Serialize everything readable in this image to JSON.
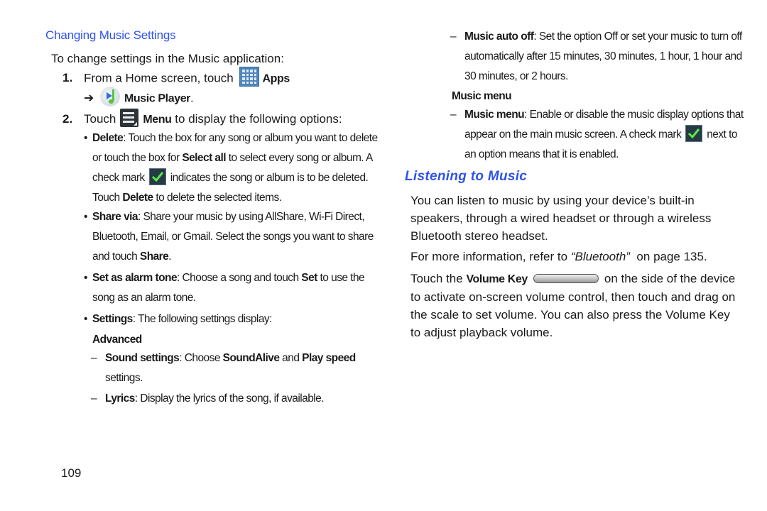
{
  "page_number": "109",
  "left_column": {
    "section_title": "Changing Music Settings",
    "intro": "To change settings in the Music application:",
    "step1": {
      "number": "1.",
      "text_before": "From a Home screen, touch",
      "apps_icon": "apps-grid-icon",
      "apps_label": "Apps",
      "arrow": "➔",
      "music_icon": "music-player-icon",
      "music_label": "Music Player",
      "end": "."
    },
    "step2": {
      "number": "2.",
      "text_before": "Touch",
      "menu_icon": "menu-icon",
      "menu_label": "Menu",
      "text_after": "to display the following options:"
    },
    "bullets": {
      "delete": {
        "label": "Delete",
        "line1": ": Touch the box for any song or album you want to delete",
        "line2_a": "or touch the box for ",
        "line2_b": "Select all",
        "line2_c": " to select every song or album. A",
        "line3_a": "check mark",
        "check_icon": "checkmark-icon",
        "line3_b": "indicates the song or album is to be deleted.",
        "line4_a": "Touch ",
        "line4_b": "Delete",
        "line4_c": " to delete the selected items."
      },
      "share": {
        "label": "Share via",
        "line1": ": Share your music by using AllShare, Wi-Fi Direct,",
        "line2": "Bluetooth, Email, or Gmail. Select the songs you want to share",
        "line3_a": "and touch ",
        "line3_b": "Share",
        "line3_c": "."
      },
      "alarm": {
        "label": "Set as alarm tone",
        "line1_a": ": Choose a song and touch ",
        "line1_b": "Set",
        "line1_c": " to use the",
        "line2": "song as an alarm tone."
      },
      "settings": {
        "label": "Settings",
        "line1": ": The following settings display:"
      }
    },
    "advanced": {
      "heading": "Advanced",
      "sound": {
        "label": "Sound settings",
        "a": ": Choose ",
        "b": "SoundAlive",
        "c": " and ",
        "d": "Play speed",
        "line2": "settings."
      },
      "lyrics": {
        "label": "Lyrics",
        "text": ": Display the lyrics of the song, if available."
      }
    },
    "bullet_char": "•",
    "dash_char": "–"
  },
  "right_column": {
    "auto_off": {
      "label": "Music auto off",
      "line1": ": Set the option Off or set your music to turn off",
      "line2": "automatically after 15 minutes, 30 minutes, 1 hour, 1 hour and",
      "line3": "30 minutes, or 2 hours."
    },
    "music_menu_heading": "Music menu",
    "music_menu": {
      "label": "Music menu",
      "line1": ": Enable or disable the music display options that",
      "line2_a": "appear on the main music screen. A check mark",
      "line2_b": "next to",
      "line3": "an option means that it is enabled."
    },
    "listening_title": "Listening to Music",
    "para1": [
      "You can listen to music by using your device’s built-in",
      "speakers, through a wired headset or through a wireless",
      "Bluetooth stereo headset."
    ],
    "ref": {
      "a": "For more information, refer to ",
      "b": "“Bluetooth”",
      "c": "  on page 135."
    },
    "volume": {
      "a": "Touch the ",
      "b": "Volume Key",
      "c": "on the side of the device",
      "line2": "to activate on-screen volume control, then touch and drag on",
      "line3": "the scale to set volume. You can also press the Volume Key",
      "line4": "to adjust playback volume."
    }
  },
  "colors": {
    "heading_blue": "#2f54e8",
    "text": "#1a1a1a"
  }
}
